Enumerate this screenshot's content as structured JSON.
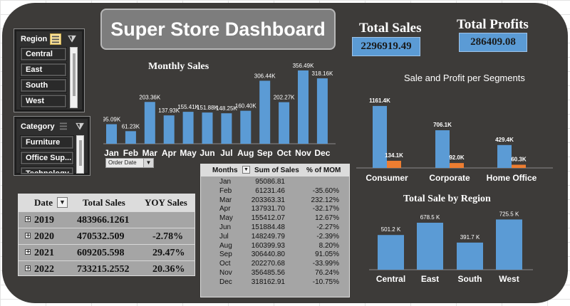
{
  "title": "Super Store Dashboard",
  "kpis": {
    "total_sales_label": "Total Sales",
    "total_sales_value": "2296919.49",
    "total_profits_label": "Total Profits",
    "total_profits_value": "286409.08"
  },
  "region_slicer": {
    "title": "Region",
    "items": [
      "Central",
      "East",
      "South",
      "West"
    ]
  },
  "category_slicer": {
    "title": "Category",
    "items": [
      "Furniture",
      "Office Sup...",
      "Technology"
    ]
  },
  "order_date_button": "Order Date",
  "yoy_table": {
    "headers": [
      "Date",
      "Total Sales",
      "YOY Sales"
    ],
    "rows": [
      {
        "year": "2019",
        "sales": "483966.1261",
        "yoy": ""
      },
      {
        "year": "2020",
        "sales": "470532.509",
        "yoy": "-2.78%"
      },
      {
        "year": "2021",
        "sales": "609205.598",
        "yoy": "29.47%"
      },
      {
        "year": "2022",
        "sales": "733215.2552",
        "yoy": "20.36%"
      }
    ]
  },
  "mom_table": {
    "headers": [
      "Months",
      "Sum of Sales",
      "% of MOM"
    ],
    "rows": [
      {
        "month": "Jan",
        "sales": "95086.81",
        "mom": ""
      },
      {
        "month": "Feb",
        "sales": "61231.46",
        "mom": "-35.60%"
      },
      {
        "month": "Mar",
        "sales": "203363.31",
        "mom": "232.12%"
      },
      {
        "month": "Apr",
        "sales": "137931.70",
        "mom": "-32.17%"
      },
      {
        "month": "May",
        "sales": "155412.07",
        "mom": "12.67%"
      },
      {
        "month": "Jun",
        "sales": "151884.48",
        "mom": "-2.27%"
      },
      {
        "month": "Jul",
        "sales": "148249.79",
        "mom": "-2.39%"
      },
      {
        "month": "Aug",
        "sales": "160399.93",
        "mom": "8.20%"
      },
      {
        "month": "Sep",
        "sales": "306440.80",
        "mom": "91.05%"
      },
      {
        "month": "Oct",
        "sales": "202270.68",
        "mom": "-33.99%"
      },
      {
        "month": "Nov",
        "sales": "356485.56",
        "mom": "76.24%"
      },
      {
        "month": "Dec",
        "sales": "318162.91",
        "mom": "-10.75%"
      }
    ]
  },
  "colors": {
    "sales_bar": "#5b9bd5",
    "profit_bar": "#ed7d31",
    "background": "#3d3b39"
  },
  "chart_data": [
    {
      "type": "bar",
      "title": "Monthly Sales",
      "categories": [
        "Jan",
        "Feb",
        "Mar",
        "Apr",
        "May",
        "Jun",
        "Jul",
        "Aug",
        "Sep",
        "Oct",
        "Nov",
        "Dec"
      ],
      "values": [
        95.09,
        61.23,
        203.36,
        137.93,
        155.41,
        151.88,
        148.25,
        160.4,
        306.44,
        202.27,
        356.49,
        318.16
      ],
      "labels": [
        "95.09K",
        "61.23K",
        "203.36K",
        "137.93K",
        "155.41K",
        "151.88K",
        "148.25K",
        "160.40K",
        "306.44K",
        "202.27K",
        "356.49K",
        "318.16K"
      ],
      "ylim": [
        0,
        360
      ]
    },
    {
      "type": "bar",
      "title": "Sale and Profit per Segments",
      "categories": [
        "Consumer",
        "Corporate",
        "Home Office"
      ],
      "series": [
        {
          "values": [
            1161.4,
            706.1,
            429.4
          ],
          "labels": [
            "1161.4K",
            "706.1K",
            "429.4K"
          ],
          "color": "#5b9bd5"
        },
        {
          "values": [
            134.1,
            92.0,
            60.3
          ],
          "labels": [
            "134.1K",
            "92.0K",
            "60.3K"
          ],
          "color": "#ed7d31"
        }
      ],
      "ylim": [
        0,
        1200
      ]
    },
    {
      "type": "bar",
      "title": "Total Sale by Region",
      "categories": [
        "Central",
        "East",
        "South",
        "West"
      ],
      "values": [
        501.2,
        678.5,
        391.7,
        725.5
      ],
      "labels": [
        "501.2 K",
        "678.5 K",
        "391.7 K",
        "725.5 K"
      ],
      "ylim": [
        0,
        740
      ]
    }
  ]
}
